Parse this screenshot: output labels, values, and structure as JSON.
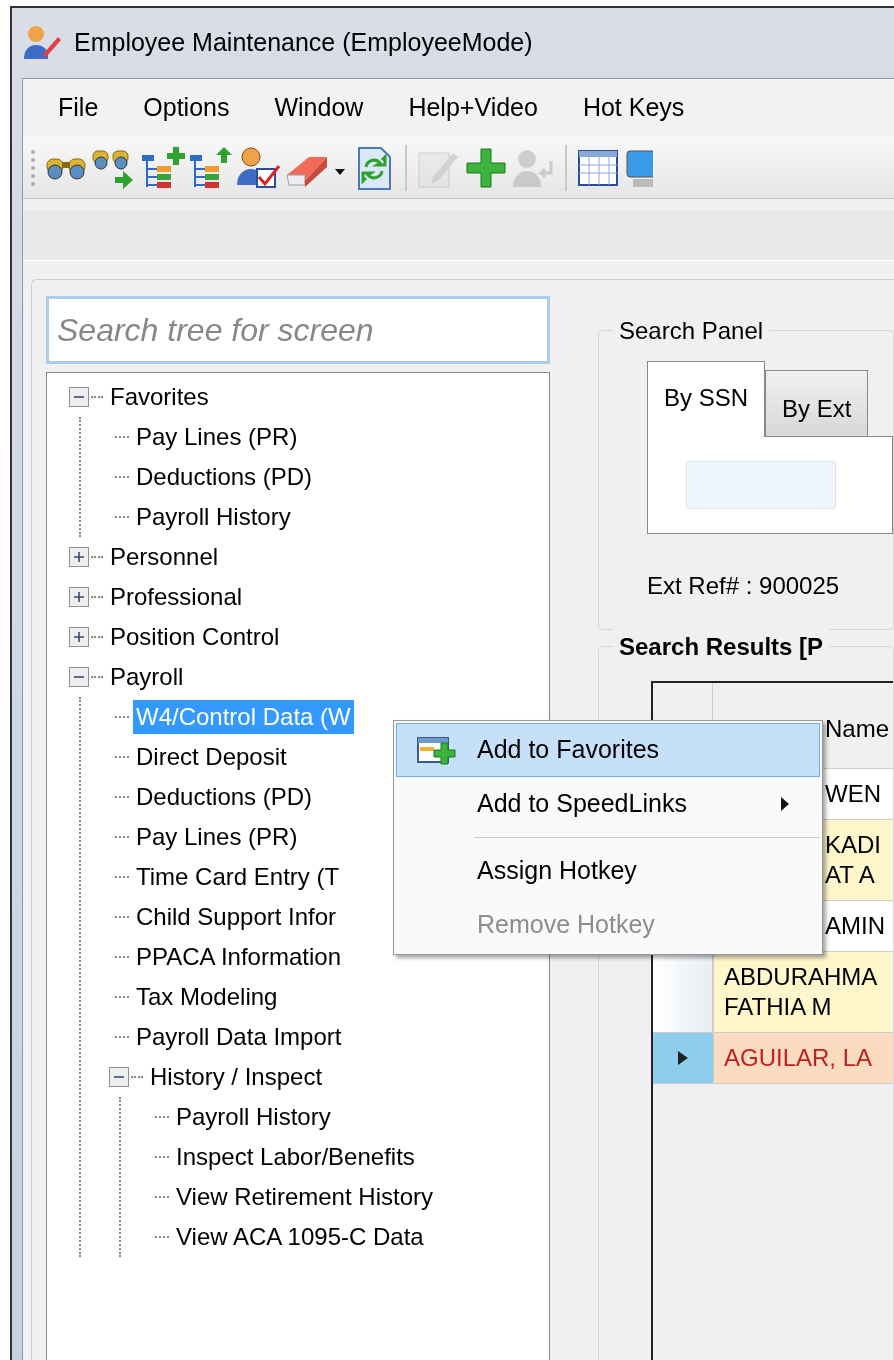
{
  "window": {
    "title": "Employee Maintenance (EmployeeMode)"
  },
  "menu_bar": [
    "File",
    "Options",
    "Window",
    "Help+Video",
    "Hot Keys"
  ],
  "toolbar": [
    {
      "kind": "binoculars",
      "disabled": false
    },
    {
      "kind": "binoculars-go",
      "disabled": false
    },
    {
      "kind": "tree-add",
      "disabled": false
    },
    {
      "kind": "tree-up",
      "disabled": false
    },
    {
      "kind": "user-check",
      "disabled": false
    },
    {
      "kind": "eraser",
      "disabled": false
    },
    {
      "kind": "refresh",
      "disabled": false
    },
    {
      "kind": "separator"
    },
    {
      "kind": "pencil",
      "disabled": true
    },
    {
      "kind": "plus",
      "disabled": false
    },
    {
      "kind": "user-back",
      "disabled": true
    },
    {
      "kind": "separator"
    },
    {
      "kind": "calendar",
      "disabled": false
    },
    {
      "kind": "monitor",
      "disabled": false
    }
  ],
  "tree_search": {
    "placeholder": "Search tree for screen"
  },
  "tree": [
    {
      "label": "Favorites",
      "expanded": true,
      "selected": false,
      "children": [
        {
          "label": "Pay Lines (PR)",
          "selected": false
        },
        {
          "label": "Deductions (PD)",
          "selected": false
        },
        {
          "label": "Payroll History",
          "selected": false
        }
      ]
    },
    {
      "label": "Personnel",
      "expanded": false,
      "selected": false
    },
    {
      "label": "Professional",
      "expanded": false,
      "selected": false
    },
    {
      "label": "Position Control",
      "expanded": false,
      "selected": false
    },
    {
      "label": "Payroll",
      "expanded": true,
      "selected": false,
      "children": [
        {
          "label": "W4/Control Data (W",
          "selected": true
        },
        {
          "label": "Direct Deposit",
          "selected": false
        },
        {
          "label": "Deductions (PD)",
          "selected": false
        },
        {
          "label": "Pay Lines (PR)",
          "selected": false
        },
        {
          "label": "Time Card Entry (T",
          "selected": false
        },
        {
          "label": "Child Support Infor",
          "selected": false
        },
        {
          "label": "PPACA Information",
          "selected": false
        },
        {
          "label": "Tax Modeling",
          "selected": false
        },
        {
          "label": "Payroll Data Import",
          "selected": false
        },
        {
          "label": "History / Inspect",
          "expanded": true,
          "selected": false,
          "children": [
            {
              "label": "Payroll History",
              "selected": false
            },
            {
              "label": "Inspect Labor/Benefits",
              "selected": false
            },
            {
              "label": "View Retirement History",
              "selected": false
            },
            {
              "label": "View ACA 1095-C Data",
              "selected": false
            }
          ]
        }
      ]
    }
  ],
  "search_panel": {
    "title": "Search Panel",
    "tabs": [
      {
        "label": "By SSN",
        "selected": true
      },
      {
        "label": "By Ext",
        "selected": false
      }
    ],
    "ext_ref": "Ext Ref# : 900025"
  },
  "search_results": {
    "title": "Search Results [P",
    "columns": [
      "Name"
    ],
    "rows": [
      {
        "lines": [
          "WEN"
        ],
        "kind": "normal"
      },
      {
        "lines": [
          "KADI",
          "AT A"
        ],
        "kind": "highlight"
      },
      {
        "lines": [
          "AMIN"
        ],
        "kind": "normal"
      },
      {
        "lines": [
          "ABDURAHMA",
          "FATHIA M"
        ],
        "kind": "highlight",
        "selected": false
      },
      {
        "lines": [
          "AGUILAR, LA"
        ],
        "kind": "alert",
        "selected": true
      }
    ]
  },
  "context_menu": [
    {
      "kind": "item",
      "label": "Add to Favorites",
      "icon": true,
      "selected": true,
      "submenu": false,
      "disabled": false
    },
    {
      "kind": "item",
      "label": "Add to SpeedLinks",
      "icon": false,
      "selected": false,
      "submenu": true,
      "disabled": false
    },
    {
      "kind": "separator"
    },
    {
      "kind": "item",
      "label": "Assign Hotkey",
      "icon": false,
      "selected": false,
      "submenu": false,
      "disabled": false
    },
    {
      "kind": "item",
      "label": "Remove Hotkey",
      "icon": false,
      "selected": false,
      "submenu": false,
      "disabled": true
    }
  ]
}
